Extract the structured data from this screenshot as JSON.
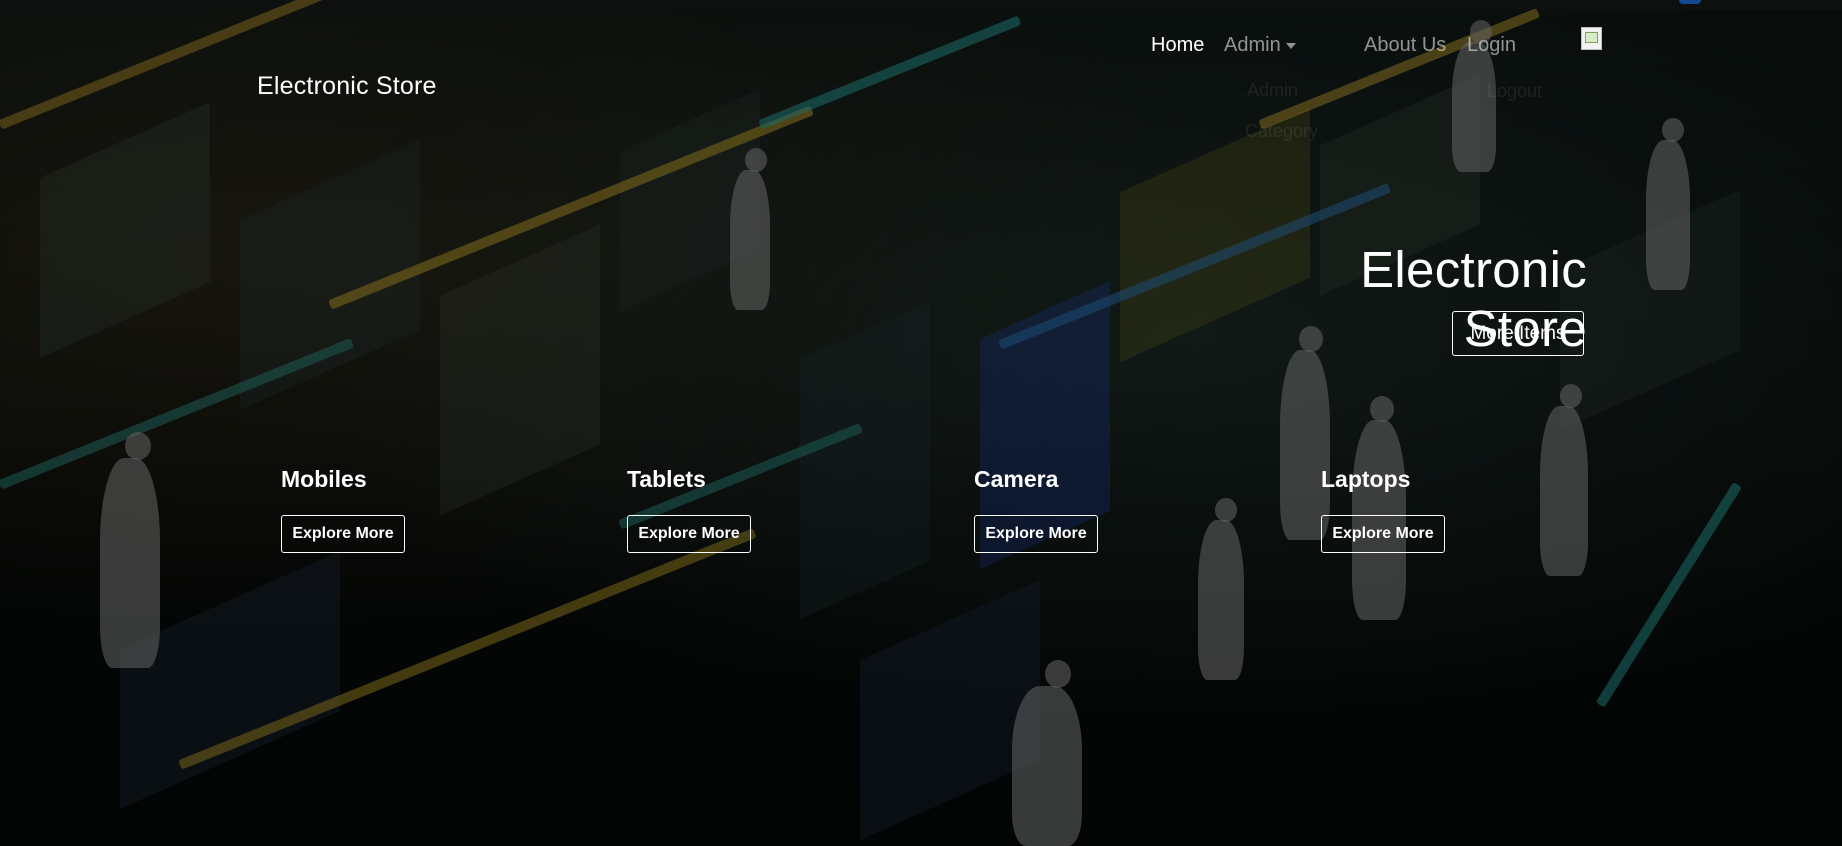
{
  "nav": {
    "brand": "Electronic Store",
    "links": {
      "home": "Home",
      "admin": "Admin",
      "about": "About Us",
      "login": "Login"
    },
    "ghost_items": [
      "Admin",
      "Category",
      "Logout"
    ]
  },
  "hero": {
    "title": "Electronic Store",
    "button": "More Items"
  },
  "categories": [
    {
      "title": "Mobiles",
      "button": "Explore More"
    },
    {
      "title": "Tablets",
      "button": "Explore More"
    },
    {
      "title": "Camera",
      "button": "Explore More"
    },
    {
      "title": "Laptops",
      "button": "Explore More"
    }
  ],
  "colors": {
    "text": "#ffffff",
    "muted_link": "#9a9a9a",
    "accent": "#1f6fe0"
  },
  "icons": {
    "profile_image": "broken-image-icon",
    "admin_dropdown": "caret-down-icon"
  }
}
